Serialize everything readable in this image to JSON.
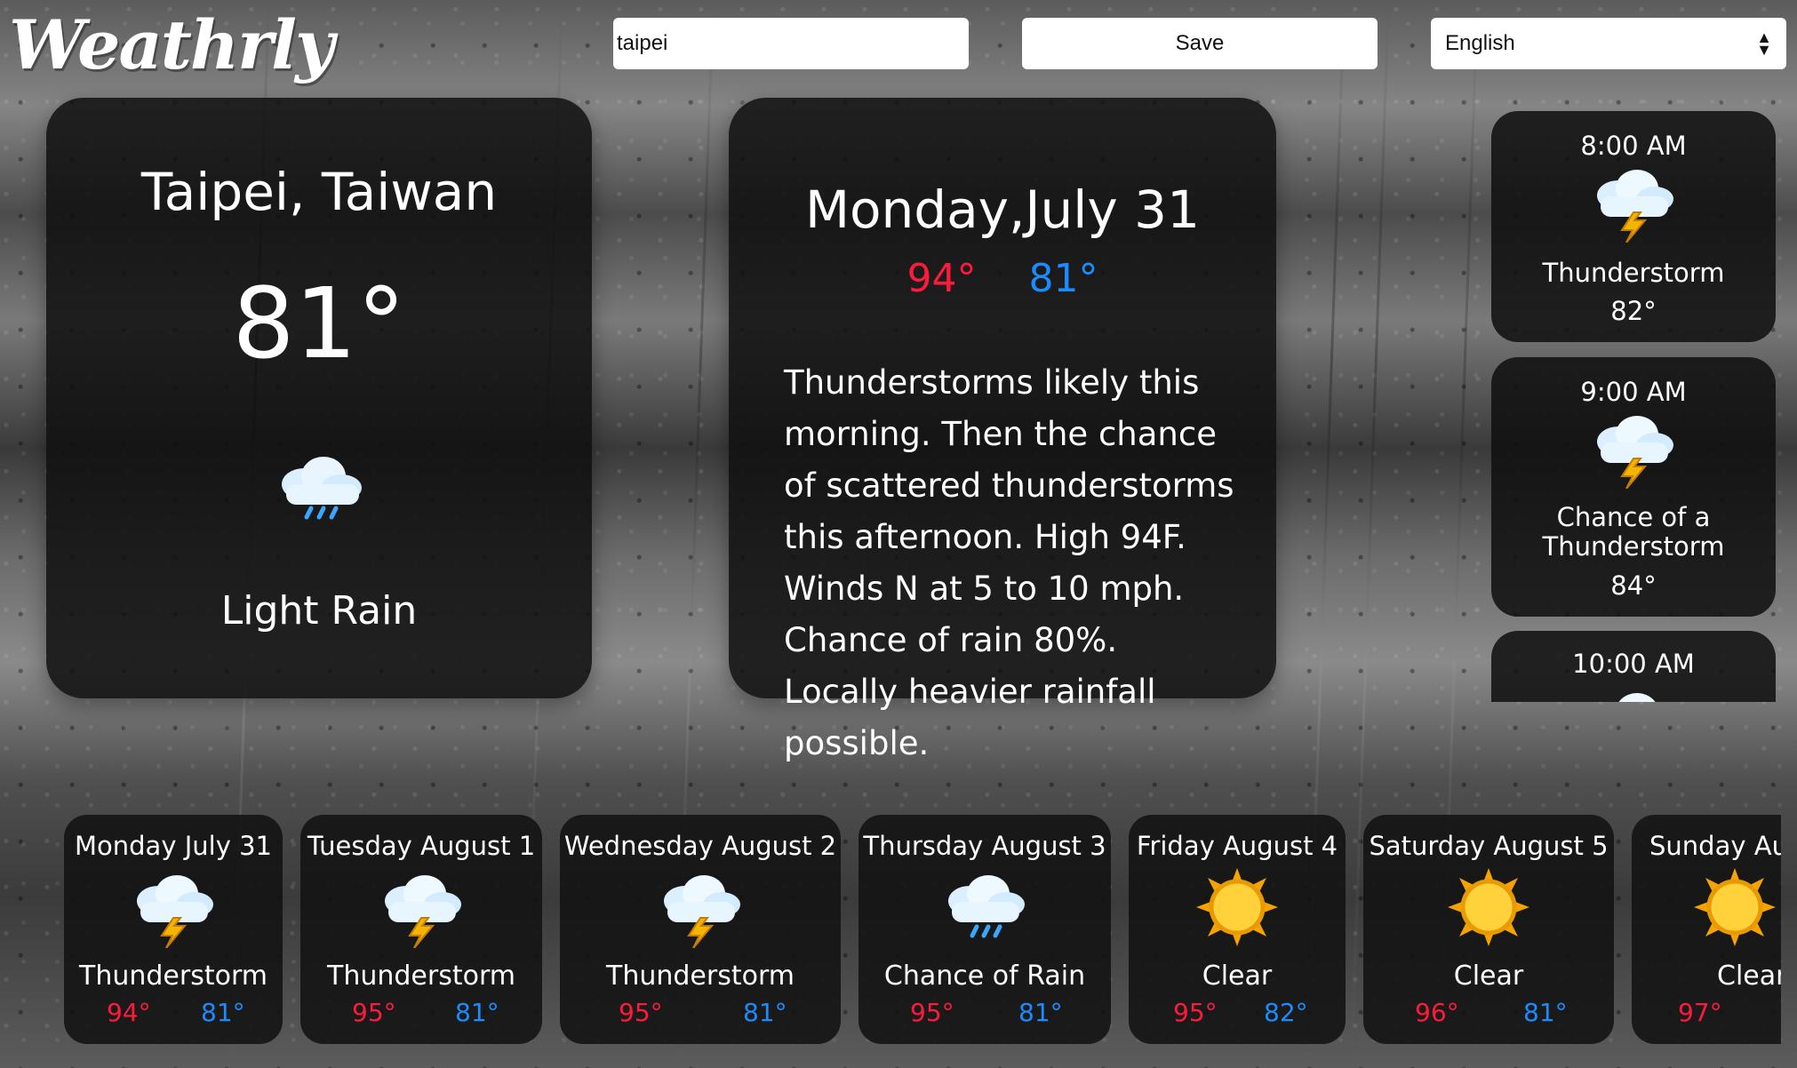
{
  "app": {
    "logo": "Weathrly"
  },
  "controls": {
    "search_value": "taipei",
    "save_label": "Save",
    "language": "English"
  },
  "current": {
    "location": "Taipei, Taiwan",
    "temperature": "81°",
    "condition": "Light Rain",
    "icon": "rain-cloud-icon"
  },
  "today": {
    "date": "Monday,July 31",
    "high": "94°",
    "low": "81°",
    "forecast": "Thunderstorms likely this morning. Then the chance of scattered thunderstorms this afternoon. High 94F. Winds N at 5 to 10 mph. Chance of rain 80%. Locally heavier rainfall possible."
  },
  "hourly": [
    {
      "time": "8:00 AM",
      "condition": "Thunderstorm",
      "temperature": "82°",
      "icon": "thunderstorm-icon"
    },
    {
      "time": "9:00 AM",
      "condition": "Chance of a Thunderstorm",
      "temperature": "84°",
      "icon": "thunderstorm-icon"
    },
    {
      "time": "10:00 AM",
      "condition": "",
      "temperature": "",
      "icon": "cloud-icon"
    }
  ],
  "daily": [
    {
      "day": "Monday July 31",
      "condition": "Thunderstorm",
      "high": "94°",
      "low": "81°",
      "icon": "thunderstorm-icon"
    },
    {
      "day": "Tuesday August 1",
      "condition": "Thunderstorm",
      "high": "95°",
      "low": "81°",
      "icon": "thunderstorm-icon"
    },
    {
      "day": "Wednesday August 2",
      "condition": "Thunderstorm",
      "high": "95°",
      "low": "81°",
      "icon": "thunderstorm-icon"
    },
    {
      "day": "Thursday August 3",
      "condition": "Chance of Rain",
      "high": "95°",
      "low": "81°",
      "icon": "rain-cloud-icon"
    },
    {
      "day": "Friday August 4",
      "condition": "Clear",
      "high": "95°",
      "low": "82°",
      "icon": "sun-icon"
    },
    {
      "day": "Saturday August 5",
      "condition": "Clear",
      "high": "96°",
      "low": "81°",
      "icon": "sun-icon"
    },
    {
      "day": "Sunday Au",
      "condition": "Clear",
      "high": "97°",
      "low": "",
      "icon": "sun-icon"
    }
  ],
  "colors": {
    "high": "#ff1a3d",
    "low": "#1a8cff",
    "panel": "#0f0f0f"
  }
}
